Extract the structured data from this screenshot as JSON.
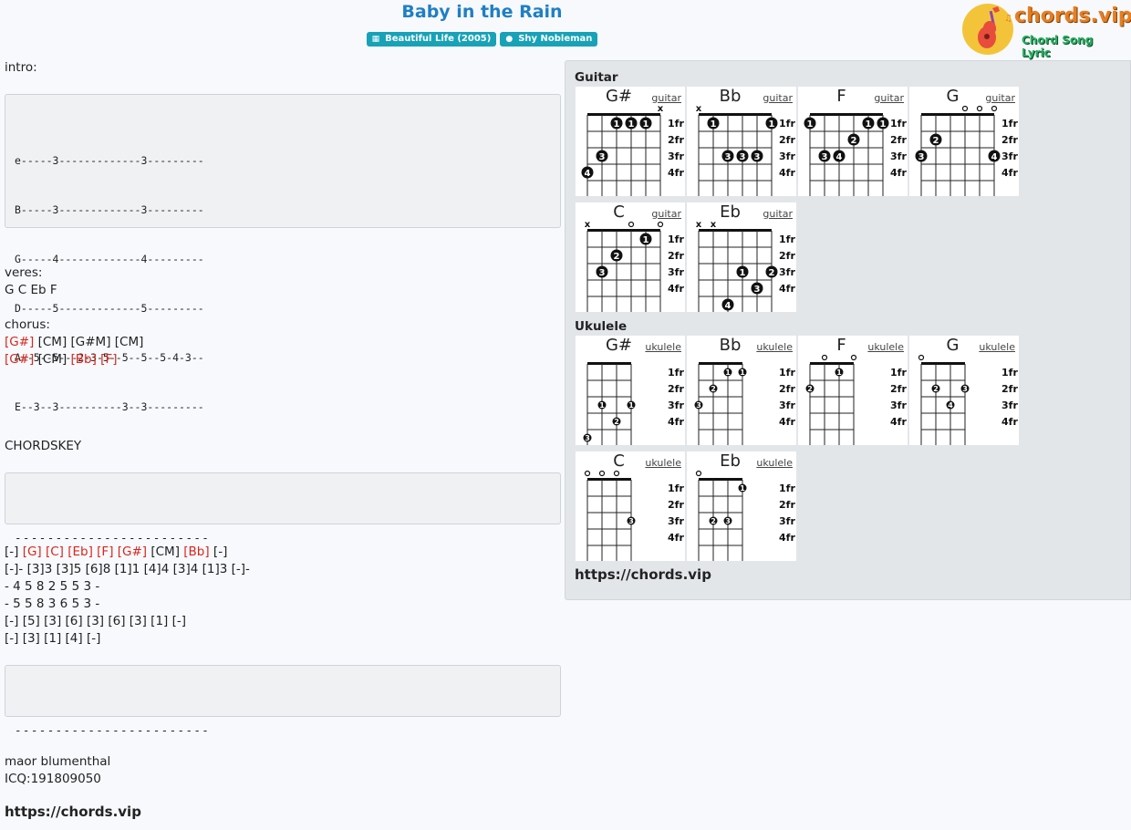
{
  "header": {
    "title": "Baby in the Rain",
    "album_badge": "Beautiful Life (2005)",
    "artist_badge": "Shy Nobleman",
    "logo_text": "chords.vip",
    "logo_tagline": "Chord Song Lyric"
  },
  "intro_label": "intro:",
  "intro_tab": [
    "e-----3-------------3---------",
    "B-----3-------------3---------",
    "G-----4-------------4---------",
    "D-----5-------------5---------",
    "A--5--5---2-3-5--5--5--5-4-3--",
    "E--3--3----------3--3---------"
  ],
  "verse_label": "veres:",
  "verse_chords": "G C Eb F",
  "chorus_label": "chorus:",
  "chorus_line1": {
    "a": "[G#]",
    "b": " [CM] [G#M] [CM]"
  },
  "chorus_line2": {
    "a": "[G#]",
    "b": " [CM] ",
    "c": "[Bb] [F]"
  },
  "chordskey_label": "CHORDSKEY",
  "dashes": "------------------------",
  "key_line1": {
    "p1": "[-] ",
    "p2": "[G] [C] [Eb] [F] [G#]",
    "p3": " [CM] ",
    "p4": "[Bb]",
    "p5": " [-]"
  },
  "key_lines": [
    "[-]- [3]3 [3]5 [6]8 [1]1 [4]4 [3]4 [1]3 [-]-",
    "- 4 5 8 2 5 5 3 -",
    "- 5 5 8 3 6 5 3 -",
    "[-] [5] [3] [6] [3] [6] [3] [1] [-]",
    "[-] [3] [1] [4] [-]"
  ],
  "credit_name": "maor blumenthal",
  "credit_icq": "ICQ:191809050",
  "footer_url": "https://chords.vip",
  "panel": {
    "guitar_label": "Guitar",
    "ukulele_label": "Ukulele",
    "url": "https://chords.vip",
    "fret_labels": [
      "1fr",
      "2fr",
      "3fr",
      "4fr"
    ],
    "guitar_link": "guitar",
    "ukulele_link": "ukulele"
  },
  "guitar_chords": [
    {
      "name": "G#",
      "marks": [
        "",
        "",
        "",
        "",
        "",
        "x"
      ],
      "dots": [
        {
          "s": 0,
          "f": 4,
          "n": "4"
        },
        {
          "s": 1,
          "f": 3,
          "n": "3"
        },
        {
          "s": 2,
          "f": 1,
          "n": "1"
        },
        {
          "s": 3,
          "f": 1,
          "n": "1"
        },
        {
          "s": 4,
          "f": 1,
          "n": "1"
        }
      ]
    },
    {
      "name": "Bb",
      "marks": [
        "x",
        "",
        "",
        "",
        "",
        ""
      ],
      "dots": [
        {
          "s": 1,
          "f": 1,
          "n": "1"
        },
        {
          "s": 2,
          "f": 3,
          "n": "3"
        },
        {
          "s": 3,
          "f": 3,
          "n": "3"
        },
        {
          "s": 4,
          "f": 3,
          "n": "3"
        },
        {
          "s": 5,
          "f": 1,
          "n": "1"
        }
      ]
    },
    {
      "name": "F",
      "marks": [
        "",
        "",
        "",
        "",
        "",
        ""
      ],
      "dots": [
        {
          "s": 0,
          "f": 1,
          "n": "1"
        },
        {
          "s": 1,
          "f": 3,
          "n": "3"
        },
        {
          "s": 2,
          "f": 3,
          "n": "4"
        },
        {
          "s": 3,
          "f": 2,
          "n": "2"
        },
        {
          "s": 4,
          "f": 1,
          "n": "1"
        },
        {
          "s": 5,
          "f": 1,
          "n": "1"
        }
      ]
    },
    {
      "name": "G",
      "marks": [
        "",
        "",
        "",
        "o",
        "o",
        "o"
      ],
      "dots": [
        {
          "s": 0,
          "f": 3,
          "n": "3"
        },
        {
          "s": 1,
          "f": 2,
          "n": "2"
        },
        {
          "s": 5,
          "f": 3,
          "n": "4"
        }
      ]
    },
    {
      "name": "C",
      "marks": [
        "x",
        "",
        "",
        "o",
        "",
        "o"
      ],
      "dots": [
        {
          "s": 1,
          "f": 3,
          "n": "3"
        },
        {
          "s": 2,
          "f": 2,
          "n": "2"
        },
        {
          "s": 4,
          "f": 1,
          "n": "1"
        }
      ]
    },
    {
      "name": "Eb",
      "marks": [
        "x",
        "x",
        "",
        "",
        "",
        ""
      ],
      "dots": [
        {
          "s": 2,
          "f": 5,
          "n": "4"
        },
        {
          "s": 3,
          "f": 3,
          "n": "1"
        },
        {
          "s": 4,
          "f": 4,
          "n": "3"
        },
        {
          "s": 5,
          "f": 3,
          "n": "2"
        }
      ]
    }
  ],
  "ukulele_chords": [
    {
      "name": "G#",
      "marks": [
        "",
        "",
        "",
        ""
      ],
      "dots": [
        {
          "s": 0,
          "f": 5,
          "n": "3"
        },
        {
          "s": 1,
          "f": 3,
          "n": "1"
        },
        {
          "s": 2,
          "f": 4,
          "n": "2"
        },
        {
          "s": 3,
          "f": 3,
          "n": "1"
        }
      ]
    },
    {
      "name": "Bb",
      "marks": [
        "",
        "",
        "",
        ""
      ],
      "dots": [
        {
          "s": 0,
          "f": 3,
          "n": "3"
        },
        {
          "s": 1,
          "f": 2,
          "n": "2"
        },
        {
          "s": 2,
          "f": 1,
          "n": "1"
        },
        {
          "s": 3,
          "f": 1,
          "n": "1"
        }
      ]
    },
    {
      "name": "F",
      "marks": [
        "",
        "o",
        "",
        "o"
      ],
      "dots": [
        {
          "s": 0,
          "f": 2,
          "n": "2"
        },
        {
          "s": 2,
          "f": 1,
          "n": "1"
        }
      ]
    },
    {
      "name": "G",
      "marks": [
        "o",
        "",
        "",
        ""
      ],
      "dots": [
        {
          "s": 1,
          "f": 2,
          "n": "2"
        },
        {
          "s": 2,
          "f": 3,
          "n": "4"
        },
        {
          "s": 3,
          "f": 2,
          "n": "3"
        }
      ]
    },
    {
      "name": "C",
      "marks": [
        "o",
        "o",
        "o",
        ""
      ],
      "dots": [
        {
          "s": 3,
          "f": 3,
          "n": "3"
        }
      ]
    },
    {
      "name": "Eb",
      "marks": [
        "o",
        "",
        "",
        ""
      ],
      "dots": [
        {
          "s": 1,
          "f": 3,
          "n": "2"
        },
        {
          "s": 2,
          "f": 3,
          "n": "3"
        },
        {
          "s": 3,
          "f": 1,
          "n": "1"
        }
      ]
    }
  ]
}
